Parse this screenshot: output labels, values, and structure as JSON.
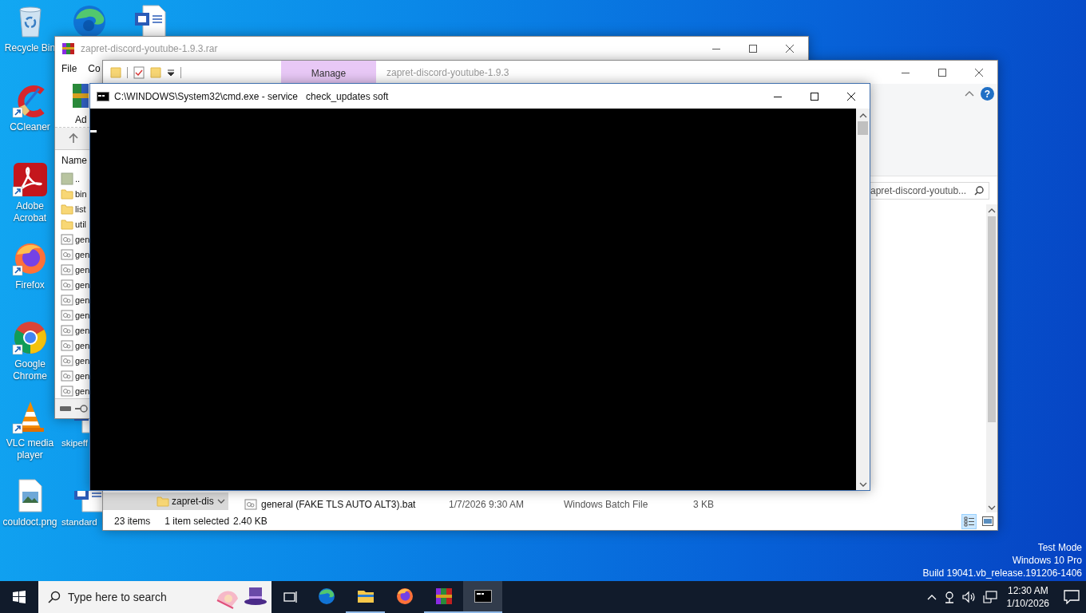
{
  "desktop": {
    "icons": [
      {
        "kind": "recycle",
        "label": "Recycle Bin",
        "shortcut": false
      },
      {
        "kind": "ccleaner",
        "label": "CCleaner",
        "shortcut": true
      },
      {
        "kind": "acrobat",
        "label": "Adobe Acrobat",
        "shortcut": true
      },
      {
        "kind": "firefox",
        "label": "Firefox",
        "shortcut": true
      },
      {
        "kind": "chrome",
        "label": "Google Chrome",
        "shortcut": true
      },
      {
        "kind": "vlc",
        "label": "VLC media player",
        "shortcut": true
      },
      {
        "kind": "image",
        "label": "couldoct.png",
        "shortcut": false
      },
      {
        "kind": "edge",
        "shortcut": false
      },
      {
        "kind": "word",
        "label": "skipeff",
        "shortcut": false
      },
      {
        "kind": "word",
        "label": "standard",
        "shortcut": false
      },
      {
        "kind": "word",
        "shortcut": false
      }
    ]
  },
  "winrar": {
    "title": "zapret-discord-youtube-1.9.3.rar",
    "menu": [
      "File",
      "Co"
    ],
    "toolbar": [
      "Ad"
    ],
    "column": "Name",
    "rows": [
      {
        "kind": "parent",
        "name": ".."
      },
      {
        "kind": "folder",
        "name": "bin"
      },
      {
        "kind": "folder",
        "name": "list"
      },
      {
        "kind": "folder",
        "name": "util"
      },
      {
        "kind": "bat",
        "name": "gen"
      },
      {
        "kind": "bat",
        "name": "gen"
      },
      {
        "kind": "bat",
        "name": "gen"
      },
      {
        "kind": "bat",
        "name": "gen"
      },
      {
        "kind": "bat",
        "name": "gen"
      },
      {
        "kind": "bat",
        "name": "gen"
      },
      {
        "kind": "bat",
        "name": "gen"
      },
      {
        "kind": "bat",
        "name": "gen"
      },
      {
        "kind": "bat",
        "name": "gen"
      },
      {
        "kind": "bat",
        "name": "gen"
      },
      {
        "kind": "bat",
        "name": "gen"
      }
    ]
  },
  "explorer": {
    "title": "zapret-discord-youtube-1.9.3",
    "ribbon_tab": "Manage",
    "help": "?",
    "search": {
      "value": "apret-discord-youtub..."
    },
    "nav": [
      {
        "label": "zapret-dis",
        "selected": true
      }
    ],
    "files": [
      {
        "kind": "bat",
        "name": "general (FAKE TLS AUTO ALT3).bat",
        "date": "1/7/2026 9:30 AM",
        "type": "Windows Batch File",
        "size": "3 KB",
        "selected": false
      }
    ],
    "status": {
      "items": "23 items",
      "selection": "1 item selected",
      "size": "2.40 KB"
    },
    "views": [
      {
        "kind": "details",
        "selected": true
      },
      {
        "kind": "thumbnails",
        "selected": false
      }
    ]
  },
  "cmd": {
    "title": "C:\\WINDOWS\\System32\\cmd.exe - service   check_updates soft"
  },
  "system_info": [
    "Test Mode",
    "Windows 10 Pro",
    "Build 19041.vb_release.191206-1406"
  ],
  "taskbar": {
    "search": {
      "placeholder": "Type here to search"
    },
    "apps": [
      {
        "kind": "edge",
        "running": false,
        "focused": false
      },
      {
        "kind": "explorer",
        "running": true,
        "focused": false
      },
      {
        "kind": "firefox",
        "running": false,
        "focused": false
      },
      {
        "kind": "winrar",
        "running": true,
        "focused": false
      },
      {
        "kind": "cmd",
        "running": true,
        "focused": true
      }
    ],
    "clock": {
      "time": "12:30 AM",
      "date": "1/10/2026"
    }
  }
}
